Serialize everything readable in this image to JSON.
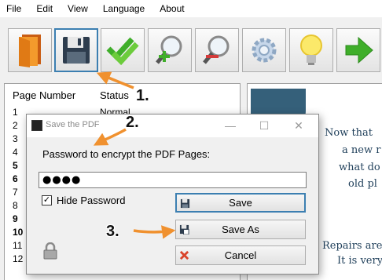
{
  "menu": [
    "File",
    "Edit",
    "View",
    "Language",
    "About"
  ],
  "toolbar": {
    "buttons": [
      {
        "name": "open-pdf-icon"
      },
      {
        "name": "save-icon",
        "active": true
      },
      {
        "name": "checkmarks-icon"
      },
      {
        "name": "add-zoom-icon"
      },
      {
        "name": "remove-zoom-icon"
      },
      {
        "name": "settings-gear-icon"
      },
      {
        "name": "lightbulb-icon"
      },
      {
        "name": "next-arrow-icon"
      }
    ]
  },
  "table": {
    "headers": [
      "Page Number",
      "Status"
    ],
    "rows": [
      {
        "num": "1",
        "status": "Normal",
        "bold": false
      },
      {
        "num": "2",
        "status": "",
        "bold": false
      },
      {
        "num": "3",
        "status": "",
        "bold": false
      },
      {
        "num": "4",
        "status": "",
        "bold": false
      },
      {
        "num": "5",
        "status": "",
        "bold": true
      },
      {
        "num": "6",
        "status": "",
        "bold": true
      },
      {
        "num": "7",
        "status": "",
        "bold": false
      },
      {
        "num": "8",
        "status": "",
        "bold": false
      },
      {
        "num": "9",
        "status": "",
        "bold": true
      },
      {
        "num": "10",
        "status": "",
        "bold": true
      },
      {
        "num": "11",
        "status": "",
        "bold": false
      },
      {
        "num": "12",
        "status": "",
        "bold": false
      }
    ]
  },
  "preview": {
    "lines": [
      "Now that",
      "a new r",
      "what do",
      "old pl",
      "Repairs are",
      "It is very"
    ]
  },
  "dialog": {
    "title": "Save the PDF",
    "label": "Password to encrypt the PDF Pages:",
    "password_value": "●●●●",
    "hide_password_label": "Hide Password",
    "hide_password_checked": "✓",
    "save_label": "Save",
    "save_as_label": "Save As",
    "cancel_label": "Cancel"
  },
  "annotations": {
    "step1": "1.",
    "step2": "2.",
    "step3": "3."
  },
  "colors": {
    "accent": "#3c7fb1",
    "arrow": "#f0912f",
    "preview_text": "#1f3f5a"
  }
}
